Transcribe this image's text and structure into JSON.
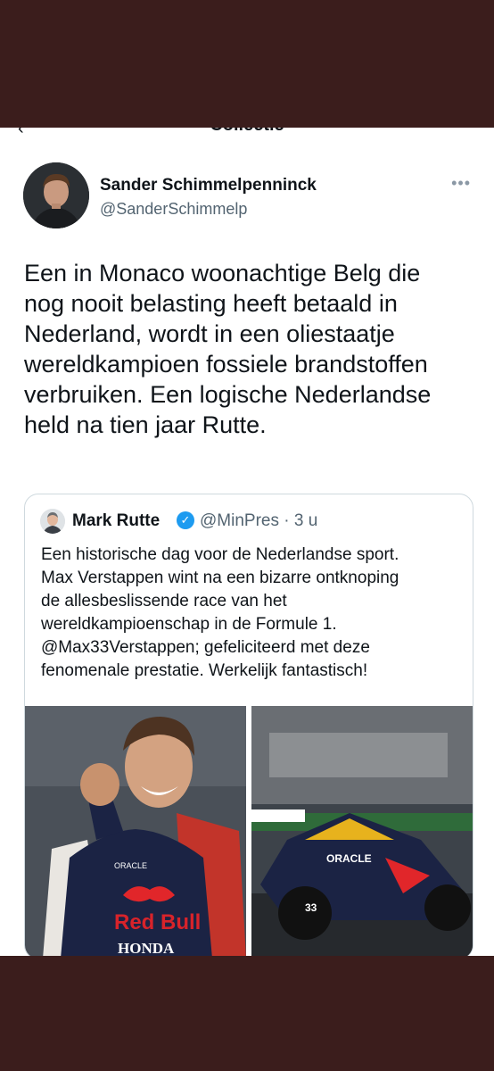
{
  "header": {
    "title_partial": "Collectie"
  },
  "tweet": {
    "author_name": "Sander Schimmelpenninck",
    "author_handle": "@SanderSchimmelp",
    "more_icon": "more-horizontal-icon",
    "lines": [
      "Een in Monaco woonachtige Belg die",
      "nog nooit belasting heeft betaald in",
      "Nederland, wordt in een oliestaatje",
      "wereldkampioen fossiele brandstoffen",
      "verbruiken. Een logische Nederlandse",
      "held na tien jaar Rutte."
    ]
  },
  "quote": {
    "author_name": "Mark Rutte",
    "verified_icon": "verified-badge-icon",
    "handle_time": "@MinPres · 3 u",
    "lines": [
      "Een historische dag voor de Nederlandse sport.",
      "Max Verstappen wint na een bizarre ontknoping",
      "de allesbeslissende race van het",
      "wereldkampioenschap in de Formule 1.",
      "@Max33Verstappen; gefeliciteerd met deze",
      "fenomenale prestatie. Werkelijk fantastisch!"
    ],
    "photo_left_texts": {
      "sponsor": "Red Bull",
      "maker": "HONDA",
      "oracle": "ORACLE"
    },
    "photo_right_texts": {
      "oracle": "ORACLE",
      "number": "33"
    }
  },
  "colors": {
    "frame": "#3b1d1c",
    "link_blue": "#1d9bf0",
    "muted": "#536471",
    "text": "#0f1419"
  }
}
